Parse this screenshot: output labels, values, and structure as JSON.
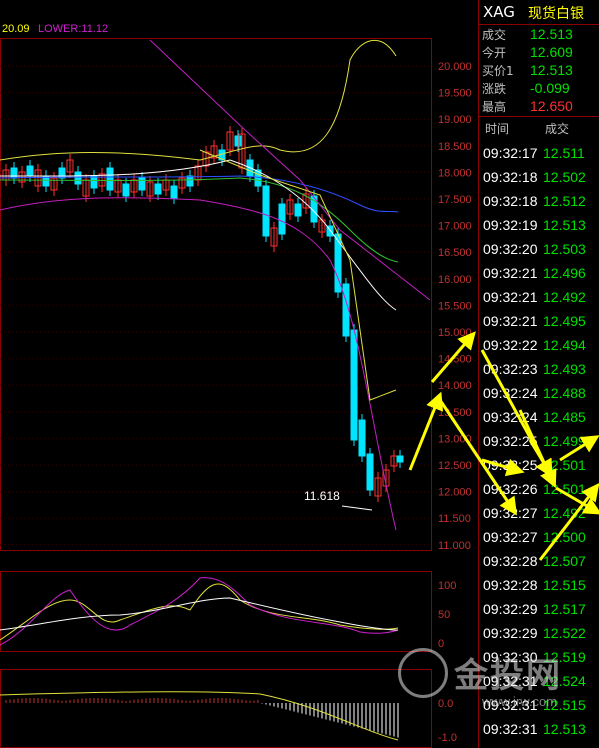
{
  "indicator": {
    "upper_partial": "20.09",
    "lower": "LOWER:11.12"
  },
  "price_labels": [
    "20.000",
    "19.500",
    "19.000",
    "18.500",
    "18.000",
    "17.500",
    "17.000",
    "16.500",
    "16.000",
    "15.500",
    "15.000",
    "14.500",
    "14.000",
    "13.500",
    "13.000",
    "12.500",
    "12.000",
    "11.500",
    "11.000"
  ],
  "low_mark": "11.618",
  "kdj_labels": [
    "100",
    "50",
    "0"
  ],
  "macd_labels": [
    "0.0",
    "-1.0"
  ],
  "header": {
    "symbol": "XAG",
    "name": "现货白银"
  },
  "quote": [
    {
      "label": "成交",
      "value": "12.513",
      "color": "#00e000"
    },
    {
      "label": "今开",
      "value": "12.609",
      "color": "#00e000"
    },
    {
      "label": "买价1",
      "value": "12.513",
      "color": "#00e000"
    },
    {
      "label": "涨跌",
      "value": "-0.099",
      "color": "#00e000"
    },
    {
      "label": "最高",
      "value": "12.650",
      "color": "#ff3030"
    }
  ],
  "ticks_header": {
    "time": "时间",
    "price": "成交"
  },
  "ticks": [
    {
      "time": "09:32:17",
      "price": "12.511"
    },
    {
      "time": "09:32:18",
      "price": "12.502"
    },
    {
      "time": "09:32:18",
      "price": "12.512"
    },
    {
      "time": "09:32:19",
      "price": "12.513"
    },
    {
      "time": "09:32:20",
      "price": "12.503"
    },
    {
      "time": "09:32:21",
      "price": "12.496"
    },
    {
      "time": "09:32:21",
      "price": "12.492"
    },
    {
      "time": "09:32:21",
      "price": "12.495"
    },
    {
      "time": "09:32:22",
      "price": "12.494"
    },
    {
      "time": "09:32:23",
      "price": "12.493"
    },
    {
      "time": "09:32:24",
      "price": "12.488"
    },
    {
      "time": "09:32:24",
      "price": "12.485"
    },
    {
      "time": "09:32:25",
      "price": "12.499"
    },
    {
      "time": "09:32:25",
      "price": "12.501"
    },
    {
      "time": "09:32:26",
      "price": "12.501"
    },
    {
      "time": "09:32:27",
      "price": "12.492"
    },
    {
      "time": "09:32:27",
      "price": "12.500"
    },
    {
      "time": "09:32:28",
      "price": "12.507"
    },
    {
      "time": "09:32:28",
      "price": "12.515"
    },
    {
      "time": "09:32:29",
      "price": "12.517"
    },
    {
      "time": "09:32:29",
      "price": "12.522"
    },
    {
      "time": "09:32:30",
      "price": "12.519"
    },
    {
      "time": "09:32:31",
      "price": "12.524"
    },
    {
      "time": "09:32:31",
      "price": "12.515"
    },
    {
      "time": "09:32:31",
      "price": "12.513"
    }
  ],
  "watermark": {
    "text": "金投网",
    "url": "www.jrw.com"
  },
  "colors": {
    "border": "#8b0000",
    "green": "#00e000",
    "red": "#ff3030",
    "arrow": "#ffff00",
    "up_candle": "#ff3030",
    "down_candle": "#00e5ff"
  }
}
